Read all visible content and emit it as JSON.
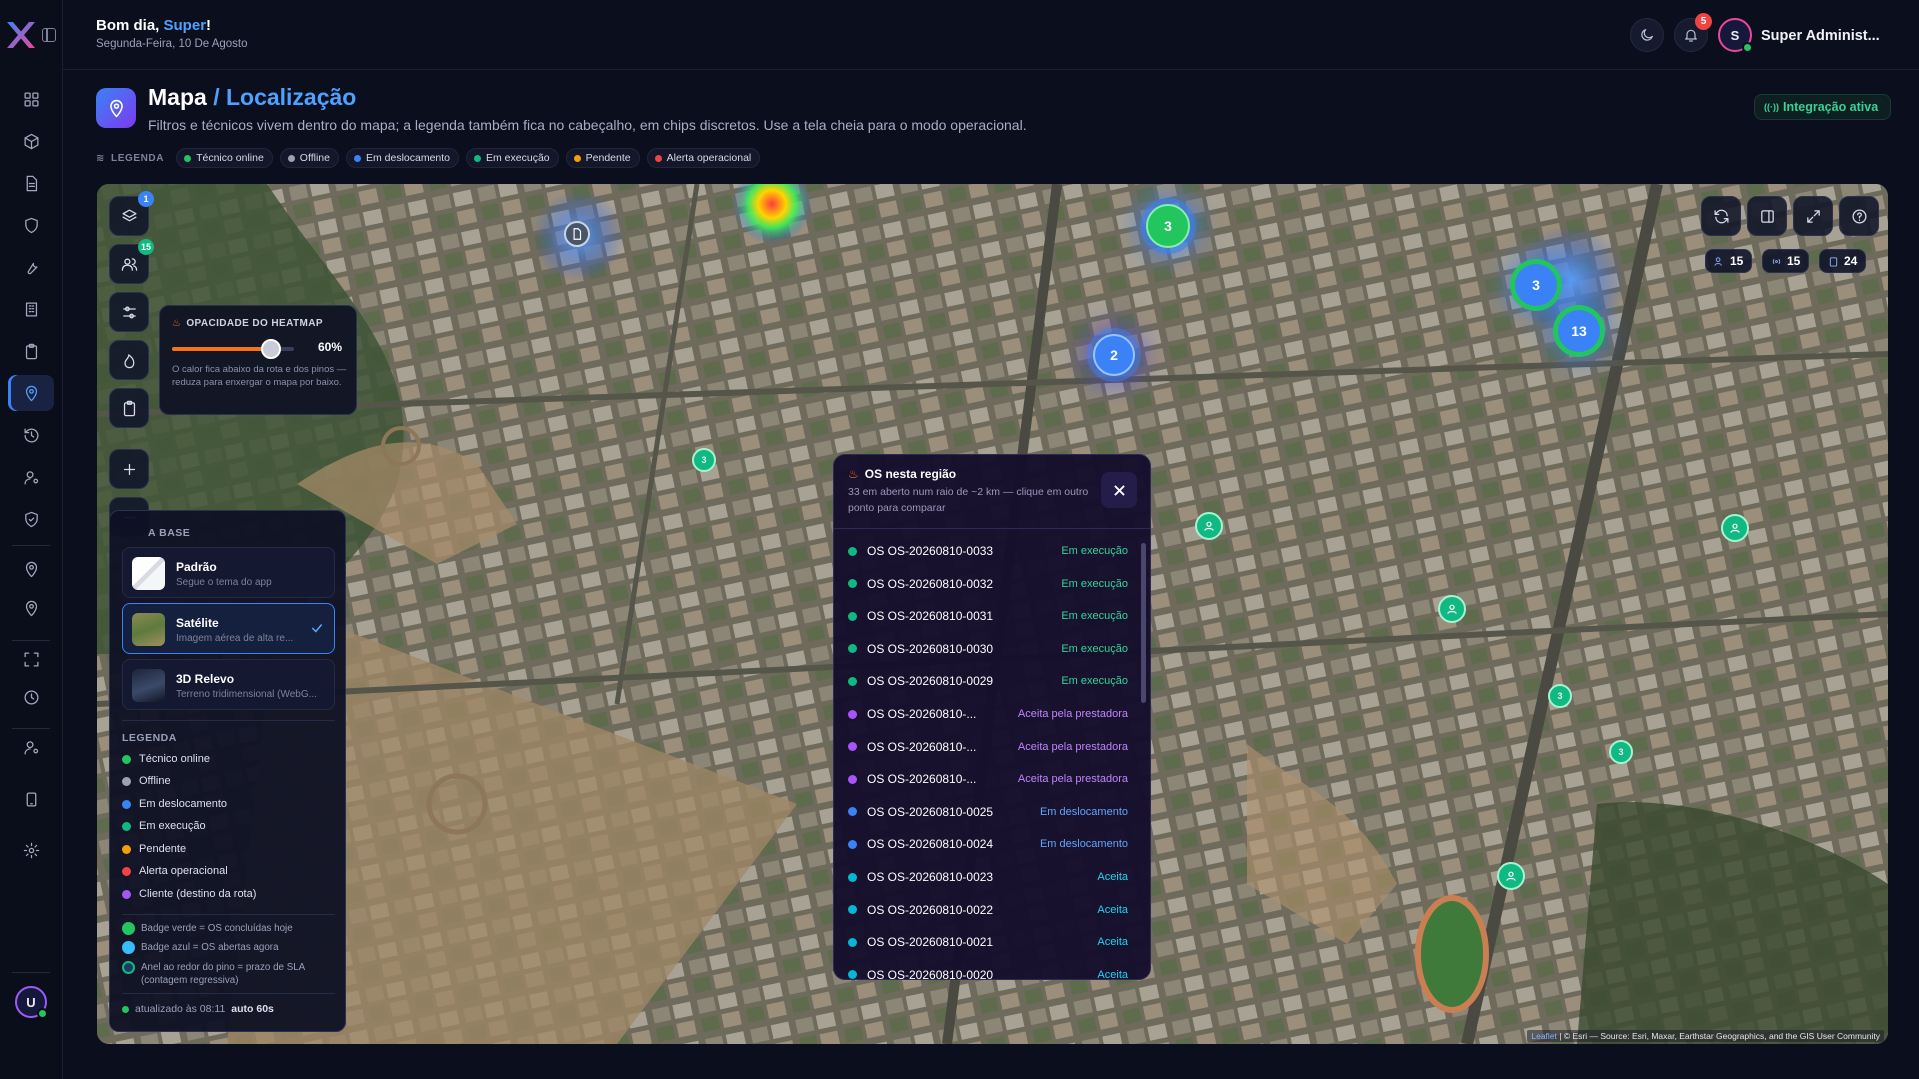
{
  "header": {
    "greeting_prefix": "Bom dia, ",
    "greeting_name": "Super",
    "greeting_suffix": "!",
    "date": "Segunda-Feira, 10 De Agosto",
    "notifications_count": "5",
    "user_initial": "S",
    "user_name": "Super Administ..."
  },
  "sidebar": {
    "avatar_initial": "U",
    "items": [
      "dashboard-icon",
      "box-icon",
      "document-icon",
      "shield-icon",
      "wrench-icon",
      "building-icon",
      "clipboard-icon",
      "map-pin-icon",
      "history-icon",
      "user-cog-icon",
      "shield-check-icon",
      "location-icon",
      "location-2-icon",
      "scan-icon",
      "clock-icon",
      "user-settings-icon",
      "tablet-icon",
      "settings-icon"
    ]
  },
  "page": {
    "title": "Mapa",
    "title_sub": "/ Localização",
    "description": "Filtros e técnicos vivem dentro do mapa; a legenda também fica no cabeçalho, em chips discretos. Use a tela cheia para o modo operacional.",
    "integration_status": "Integração ativa"
  },
  "legend_chips": {
    "title": "LEGENDA",
    "items": [
      {
        "label": "Técnico online",
        "color": "#22c55e"
      },
      {
        "label": "Offline",
        "color": "#9ca3af"
      },
      {
        "label": "Em deslocamento",
        "color": "#3b82f6"
      },
      {
        "label": "Em execução",
        "color": "#10b981"
      },
      {
        "label": "Pendente",
        "color": "#f59e0b"
      },
      {
        "label": "Alerta operacional",
        "color": "#ef4444"
      }
    ]
  },
  "map": {
    "controls": {
      "layers_badge": "1",
      "technicians_badge": "15"
    },
    "counts": {
      "technicians": "15",
      "online": "15",
      "orders": "24"
    },
    "clusters": [
      "3",
      "2",
      "3",
      "13"
    ],
    "pin_clusters": [
      "3",
      "3",
      "3",
      "3"
    ],
    "heatmap": {
      "title": "OPACIDADE DO HEATMAP",
      "value_percent": 60,
      "value_label": "60%",
      "note": "O calor fica abaixo da rota e dos pinos — reduza para enxergar o mapa por baixo."
    },
    "base_layer": {
      "title": "A BASE",
      "options": [
        {
          "name": "Padrão",
          "sub": "Segue o tema do app",
          "selected": false
        },
        {
          "name": "Satélite",
          "sub": "Imagem aérea de alta re...",
          "selected": true
        },
        {
          "name": "3D Relevo",
          "sub": "Terreno tridimensional (WebG...",
          "selected": false
        }
      ]
    },
    "legend": {
      "title": "LEGENDA",
      "items": [
        {
          "label": "Técnico online",
          "color": "#22c55e"
        },
        {
          "label": "Offline",
          "color": "#9ca3af"
        },
        {
          "label": "Em deslocamento",
          "color": "#3b82f6"
        },
        {
          "label": "Em execução",
          "color": "#10b981"
        },
        {
          "label": "Pendente",
          "color": "#f59e0b"
        },
        {
          "label": "Alerta operacional",
          "color": "#ef4444"
        },
        {
          "label": "Cliente (destino da rota)",
          "color": "#a855f7"
        }
      ],
      "notes": [
        {
          "label": "Badge verde = OS concluídas hoje",
          "color": "#22c55e"
        },
        {
          "label": "Badge azul = OS abertas agora",
          "color": "#38bdf8"
        },
        {
          "label": "Anel ao redor do pino = prazo de SLA (contagem regressiva)",
          "color": "#10b981"
        }
      ],
      "updated_label": "atualizado às 08:11",
      "auto_label": "auto 60s"
    },
    "attribution_leaflet": "Leaflet",
    "attribution_rest": " | © Esri — Source: Esri, Maxar, Earthstar Geographics, and the GIS User Community"
  },
  "os_panel": {
    "title": "OS nesta região",
    "subtitle": "33 em aberto num raio de ~2 km — clique em outro ponto para comparar",
    "rows": [
      {
        "code": "OS OS-20260810-0033",
        "status": "Em execução",
        "color": "#10b981",
        "status_color": "#34d399"
      },
      {
        "code": "OS OS-20260810-0032",
        "status": "Em execução",
        "color": "#10b981",
        "status_color": "#34d399"
      },
      {
        "code": "OS OS-20260810-0031",
        "status": "Em execução",
        "color": "#10b981",
        "status_color": "#34d399"
      },
      {
        "code": "OS OS-20260810-0030",
        "status": "Em execução",
        "color": "#10b981",
        "status_color": "#34d399"
      },
      {
        "code": "OS OS-20260810-0029",
        "status": "Em execução",
        "color": "#10b981",
        "status_color": "#34d399"
      },
      {
        "code": "OS OS-20260810-...",
        "status": "Aceita pela prestadora",
        "color": "#a855f7",
        "status_color": "#c084fc"
      },
      {
        "code": "OS OS-20260810-...",
        "status": "Aceita pela prestadora",
        "color": "#a855f7",
        "status_color": "#c084fc"
      },
      {
        "code": "OS OS-20260810-...",
        "status": "Aceita pela prestadora",
        "color": "#a855f7",
        "status_color": "#c084fc"
      },
      {
        "code": "OS OS-20260810-0025",
        "status": "Em deslocamento",
        "color": "#3b82f6",
        "status_color": "#60a5fa"
      },
      {
        "code": "OS OS-20260810-0024",
        "status": "Em deslocamento",
        "color": "#3b82f6",
        "status_color": "#60a5fa"
      },
      {
        "code": "OS OS-20260810-0023",
        "status": "Aceita",
        "color": "#06b6d4",
        "status_color": "#22d3ee"
      },
      {
        "code": "OS OS-20260810-0022",
        "status": "Aceita",
        "color": "#06b6d4",
        "status_color": "#22d3ee"
      },
      {
        "code": "OS OS-20260810-0021",
        "status": "Aceita",
        "color": "#06b6d4",
        "status_color": "#22d3ee"
      },
      {
        "code": "OS OS-20260810-0020",
        "status": "Aceita",
        "color": "#06b6d4",
        "status_color": "#22d3ee"
      }
    ]
  }
}
